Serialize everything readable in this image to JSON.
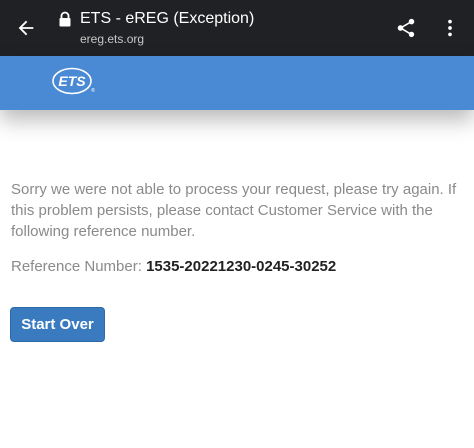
{
  "browser": {
    "title": "ETS - eREG (Exception)",
    "url": "ereg.ets.org",
    "icons": {
      "back": "arrow-back-icon",
      "lock": "lock-icon",
      "share": "share-icon",
      "menu": "more-vert-icon"
    }
  },
  "header": {
    "logo_text": "ETS",
    "logo_mark": "®",
    "color": "#4a89d4"
  },
  "error": {
    "message": "Sorry we were not able to process your request, please try again. If this problem persists, please contact Customer Service with the following reference number.",
    "reference_label": "Reference Number:",
    "reference_number": "1535-20221230-0245-30252"
  },
  "actions": {
    "start_over_label": "Start Over",
    "button_color": "#3a7bc0"
  }
}
